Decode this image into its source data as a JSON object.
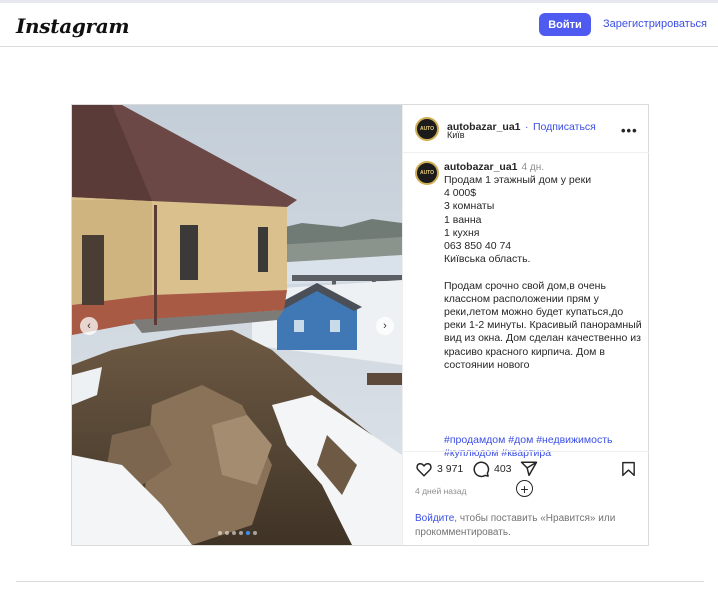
{
  "header": {
    "logo": "Instagram",
    "login_label": "Войти",
    "register_label": "Зарегистрироваться"
  },
  "post": {
    "author": {
      "username": "autobazar_ua1",
      "separator": "·",
      "follow_label": "Подписаться",
      "location": "Київ",
      "avatar_text": "AUTO"
    },
    "more_label": "•••",
    "photo": {
      "prev_icon": "chevron-left-icon",
      "next_icon": "chevron-right-icon",
      "slide_count": 6,
      "active_slide": 5
    },
    "caption": {
      "username": "autobazar_ua1",
      "time": "4 дн.",
      "text": "Продам 1 этажный дом у реки\n4 000$\n3 комнаты\n1 ванна\n1 кухня\n063 850 40 74\nКиївська область.\n\nПродам срочно свой дом,в очень классном расположении прям у реки,летом можно будет купаться,до реки 1-2 минуты. Красивый панорамный вид из окна. Дом сделан качественно из красиво красного кирпича. Дом в состоянии нового",
      "hashtags": "#продамдом #дом #недвижимость #куплюдом #квартира",
      "load_more_icon": "plus-circle-icon"
    },
    "actions": {
      "likes": "3 971",
      "comments": "403",
      "icons": [
        "heart-icon",
        "comment-icon",
        "share-icon",
        "bookmark-icon"
      ],
      "ago": "4 дней назад",
      "login_link": "Войдите",
      "login_rest": ", чтобы поставить «Нравится» или прокомментировать."
    }
  },
  "colors": {
    "accent": "#4f5bf0",
    "link": "#3b4ee6",
    "border": "#dbdbdb",
    "muted": "#8e8e8e"
  }
}
